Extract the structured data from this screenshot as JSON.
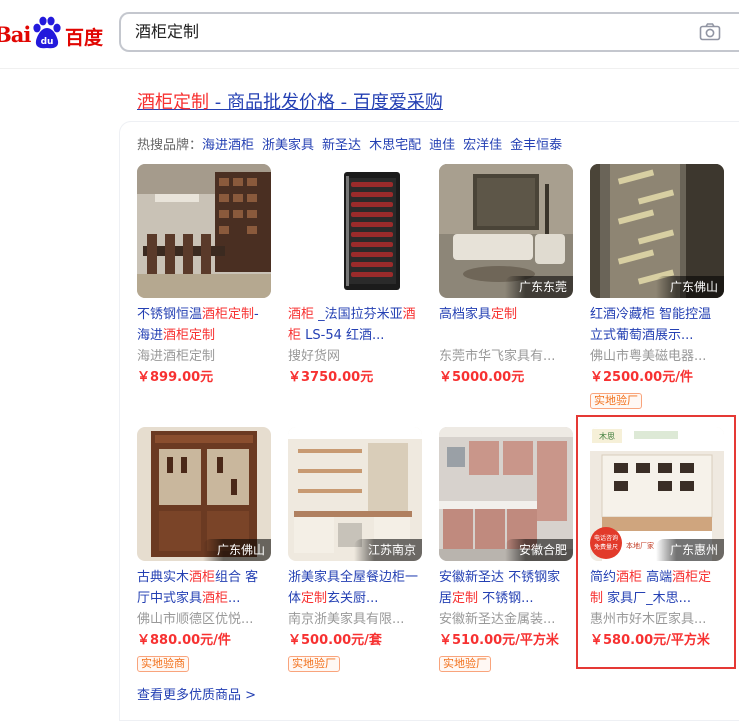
{
  "header": {
    "logo_bai": "Bai",
    "logo_du": "du",
    "logo_cn": "百度",
    "search_value": "酒柜定制"
  },
  "result": {
    "title_hl": "酒柜定制",
    "title_rest": " - 商品批发价格 - 百度爱采购"
  },
  "hot_brands": {
    "label": "热搜品牌：",
    "items": [
      "海进酒柜",
      "浙美家具",
      "新圣达",
      "木思宅配",
      "迪佳",
      "宏洋佳",
      "金丰恒泰"
    ]
  },
  "products": [
    {
      "name_parts": [
        {
          "t": "不锈钢恒温",
          "hl": false
        },
        {
          "t": "酒柜定制",
          "hl": true
        },
        {
          "t": "-海进",
          "hl": false
        },
        {
          "t": "酒柜定制",
          "hl": true
        }
      ],
      "shop": "海进酒柜定制",
      "price": "￥899.00元",
      "location": "",
      "badge": "",
      "image": "dining-room"
    },
    {
      "name_parts": [
        {
          "t": "酒柜",
          "hl": true
        },
        {
          "t": " _法国拉芬米亚",
          "hl": false
        },
        {
          "t": "酒柜",
          "hl": true
        },
        {
          "t": " LS-54 红酒...",
          "hl": false
        }
      ],
      "shop": "搜好货网",
      "price": "￥3750.00元",
      "location": "",
      "badge": "",
      "image": "fridge"
    },
    {
      "name_parts": [
        {
          "t": "高档家具",
          "hl": false
        },
        {
          "t": "定制",
          "hl": true
        }
      ],
      "shop": "东莞市华飞家具有...",
      "price": "￥5000.00元",
      "location": "广东东莞",
      "badge": "",
      "image": "living-room"
    },
    {
      "name_parts": [
        {
          "t": "红酒冷藏柜 智能控温立式葡萄酒展示...",
          "hl": false
        }
      ],
      "shop": "佛山市粤美磁电器...",
      "price": "￥2500.00元/件",
      "location": "广东佛山",
      "badge": "实地验厂",
      "image": "glass-rack"
    },
    {
      "name_parts": [
        {
          "t": "古典实木",
          "hl": false
        },
        {
          "t": "酒柜",
          "hl": true
        },
        {
          "t": "组合 客厅中式家具",
          "hl": false
        },
        {
          "t": "酒柜",
          "hl": true
        },
        {
          "t": "...",
          "hl": false
        }
      ],
      "shop": "佛山市顺德区优悦...",
      "price": "￥880.00元/件",
      "location": "广东佛山",
      "badge": "实地验商",
      "image": "wood-cabinet"
    },
    {
      "name_parts": [
        {
          "t": "浙美家具全屋餐边柜一体",
          "hl": false
        },
        {
          "t": "定制",
          "hl": true
        },
        {
          "t": "玄关厨...",
          "hl": false
        }
      ],
      "shop": "南京浙美家具有限...",
      "price": "￥500.00元/套",
      "location": "江苏南京",
      "badge": "实地验厂",
      "image": "study-room"
    },
    {
      "name_parts": [
        {
          "t": "安徽新圣达 不锈钢家居",
          "hl": false
        },
        {
          "t": "定制",
          "hl": true
        },
        {
          "t": " 不锈钢...",
          "hl": false
        }
      ],
      "shop": "安徽新圣达金属装...",
      "price": "￥510.00元/平方米",
      "location": "安徽合肥",
      "badge": "实地验厂",
      "image": "kitchen"
    },
    {
      "name_parts": [
        {
          "t": "简约",
          "hl": false
        },
        {
          "t": "酒柜",
          "hl": true
        },
        {
          "t": " 高端",
          "hl": false
        },
        {
          "t": "酒柜定制",
          "hl": true
        },
        {
          "t": " 家具厂_木思...",
          "hl": false
        }
      ],
      "shop": "惠州市好木匠家具...",
      "price": "￥580.00元/平方米",
      "location": "广东惠州",
      "badge": "",
      "image": "white-cabinet",
      "image_texts": {
        "brand": "木思",
        "tag": "本地厂家",
        "promo_line1": "电话咨询",
        "promo_line2": "免费量尺"
      }
    }
  ],
  "more_link": "查看更多优质商品 >",
  "colors": {
    "link": "#2440b3",
    "highlight": "#f73131",
    "brand_red": "#e10602",
    "selection": "#e53935"
  }
}
